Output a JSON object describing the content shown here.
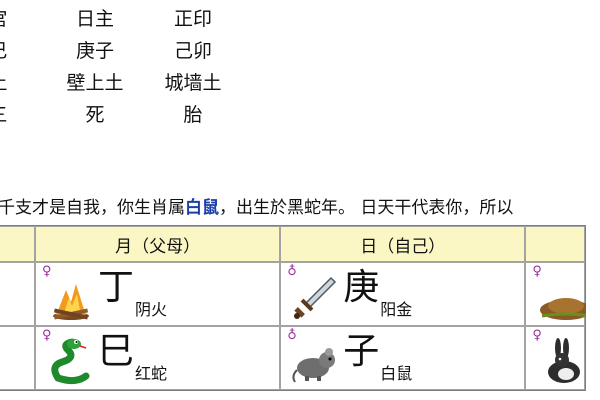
{
  "info": {
    "rows": [
      [
        "宫",
        "日主",
        "正印"
      ],
      [
        "巳",
        "庚子",
        "己卯"
      ],
      [
        "土",
        "壁上土",
        "城墙土"
      ],
      [
        "三",
        "死",
        "胎"
      ]
    ]
  },
  "intro": {
    "before": "千支才是自我，你生肖属",
    "highlight": "白鼠",
    "after": "，出生於黑蛇年。 日天干代表你，所以"
  },
  "table": {
    "headers": [
      "",
      "月（父母）",
      "日（自己）",
      ""
    ],
    "rows": [
      [
        {
          "sym": "",
          "char": "",
          "desc": "",
          "icon": ""
        },
        {
          "sym": "♀",
          "char": "丁",
          "desc": "阴火",
          "icon": "fire-icon"
        },
        {
          "sym": "♁",
          "char": "庚",
          "desc": "阳金",
          "icon": "sword-icon"
        },
        {
          "sym": "♀",
          "char": "",
          "desc": "",
          "icon": "earth-mound-icon"
        }
      ],
      [
        {
          "sym": "",
          "char": "",
          "desc": "",
          "icon": ""
        },
        {
          "sym": "♀",
          "char": "巳",
          "desc": "红蛇",
          "icon": "snake-icon"
        },
        {
          "sym": "♁",
          "char": "子",
          "desc": "白鼠",
          "icon": "rat-icon"
        },
        {
          "sym": "♀",
          "char": "",
          "desc": "",
          "icon": "rabbit-icon"
        }
      ]
    ]
  }
}
